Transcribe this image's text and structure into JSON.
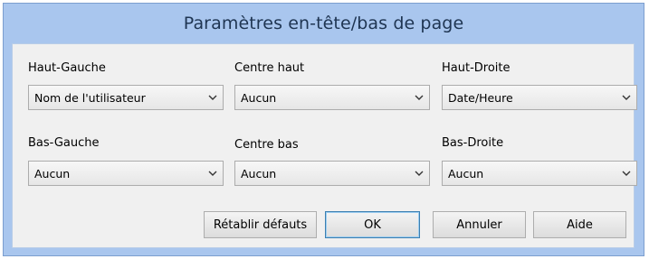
{
  "dialog": {
    "title": "Paramètres en-tête/bas de page"
  },
  "fields": {
    "top_left": {
      "label": "Haut-Gauche",
      "value": "Nom de l'utilisateur"
    },
    "top_center": {
      "label": "Centre haut",
      "value": "Aucun"
    },
    "top_right": {
      "label": "Haut-Droite",
      "value": "Date/Heure"
    },
    "bottom_left": {
      "label": "Bas-Gauche",
      "value": "Aucun"
    },
    "bottom_center": {
      "label": "Centre bas",
      "value": "Aucun"
    },
    "bottom_right": {
      "label": "Bas-Droite",
      "value": "Aucun"
    }
  },
  "buttons": {
    "restore_defaults": "Rétablir défauts",
    "ok": "OK",
    "cancel": "Annuler",
    "help": "Aide"
  },
  "colors": {
    "title_bar": "#a9c6ee",
    "client_area": "#f0f0f0",
    "default_button_border": "#3c7fb1"
  },
  "icons": {
    "dropdown_arrow": "chevron-down-icon"
  }
}
